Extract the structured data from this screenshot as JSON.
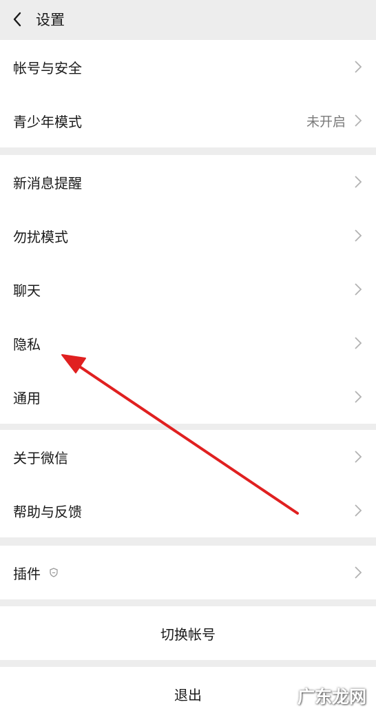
{
  "header": {
    "title": "设置"
  },
  "groups": [
    {
      "items": [
        {
          "label": "帐号与安全"
        },
        {
          "label": "青少年模式",
          "value": "未开启"
        }
      ]
    },
    {
      "items": [
        {
          "label": "新消息提醒"
        },
        {
          "label": "勿扰模式"
        },
        {
          "label": "聊天"
        },
        {
          "label": "隐私"
        },
        {
          "label": "通用"
        }
      ]
    },
    {
      "items": [
        {
          "label": "关于微信"
        },
        {
          "label": "帮助与反馈"
        }
      ]
    },
    {
      "items": [
        {
          "label": "插件"
        }
      ]
    }
  ],
  "actions": {
    "switch_account": "切换帐号",
    "logout": "退出"
  },
  "annotation": {
    "arrow_color": "#e02020"
  },
  "watermark": "广东龙网",
  "icons": {
    "back": "chevron-left-icon",
    "row": "chevron-right-icon",
    "plugin": "shield-icon"
  }
}
